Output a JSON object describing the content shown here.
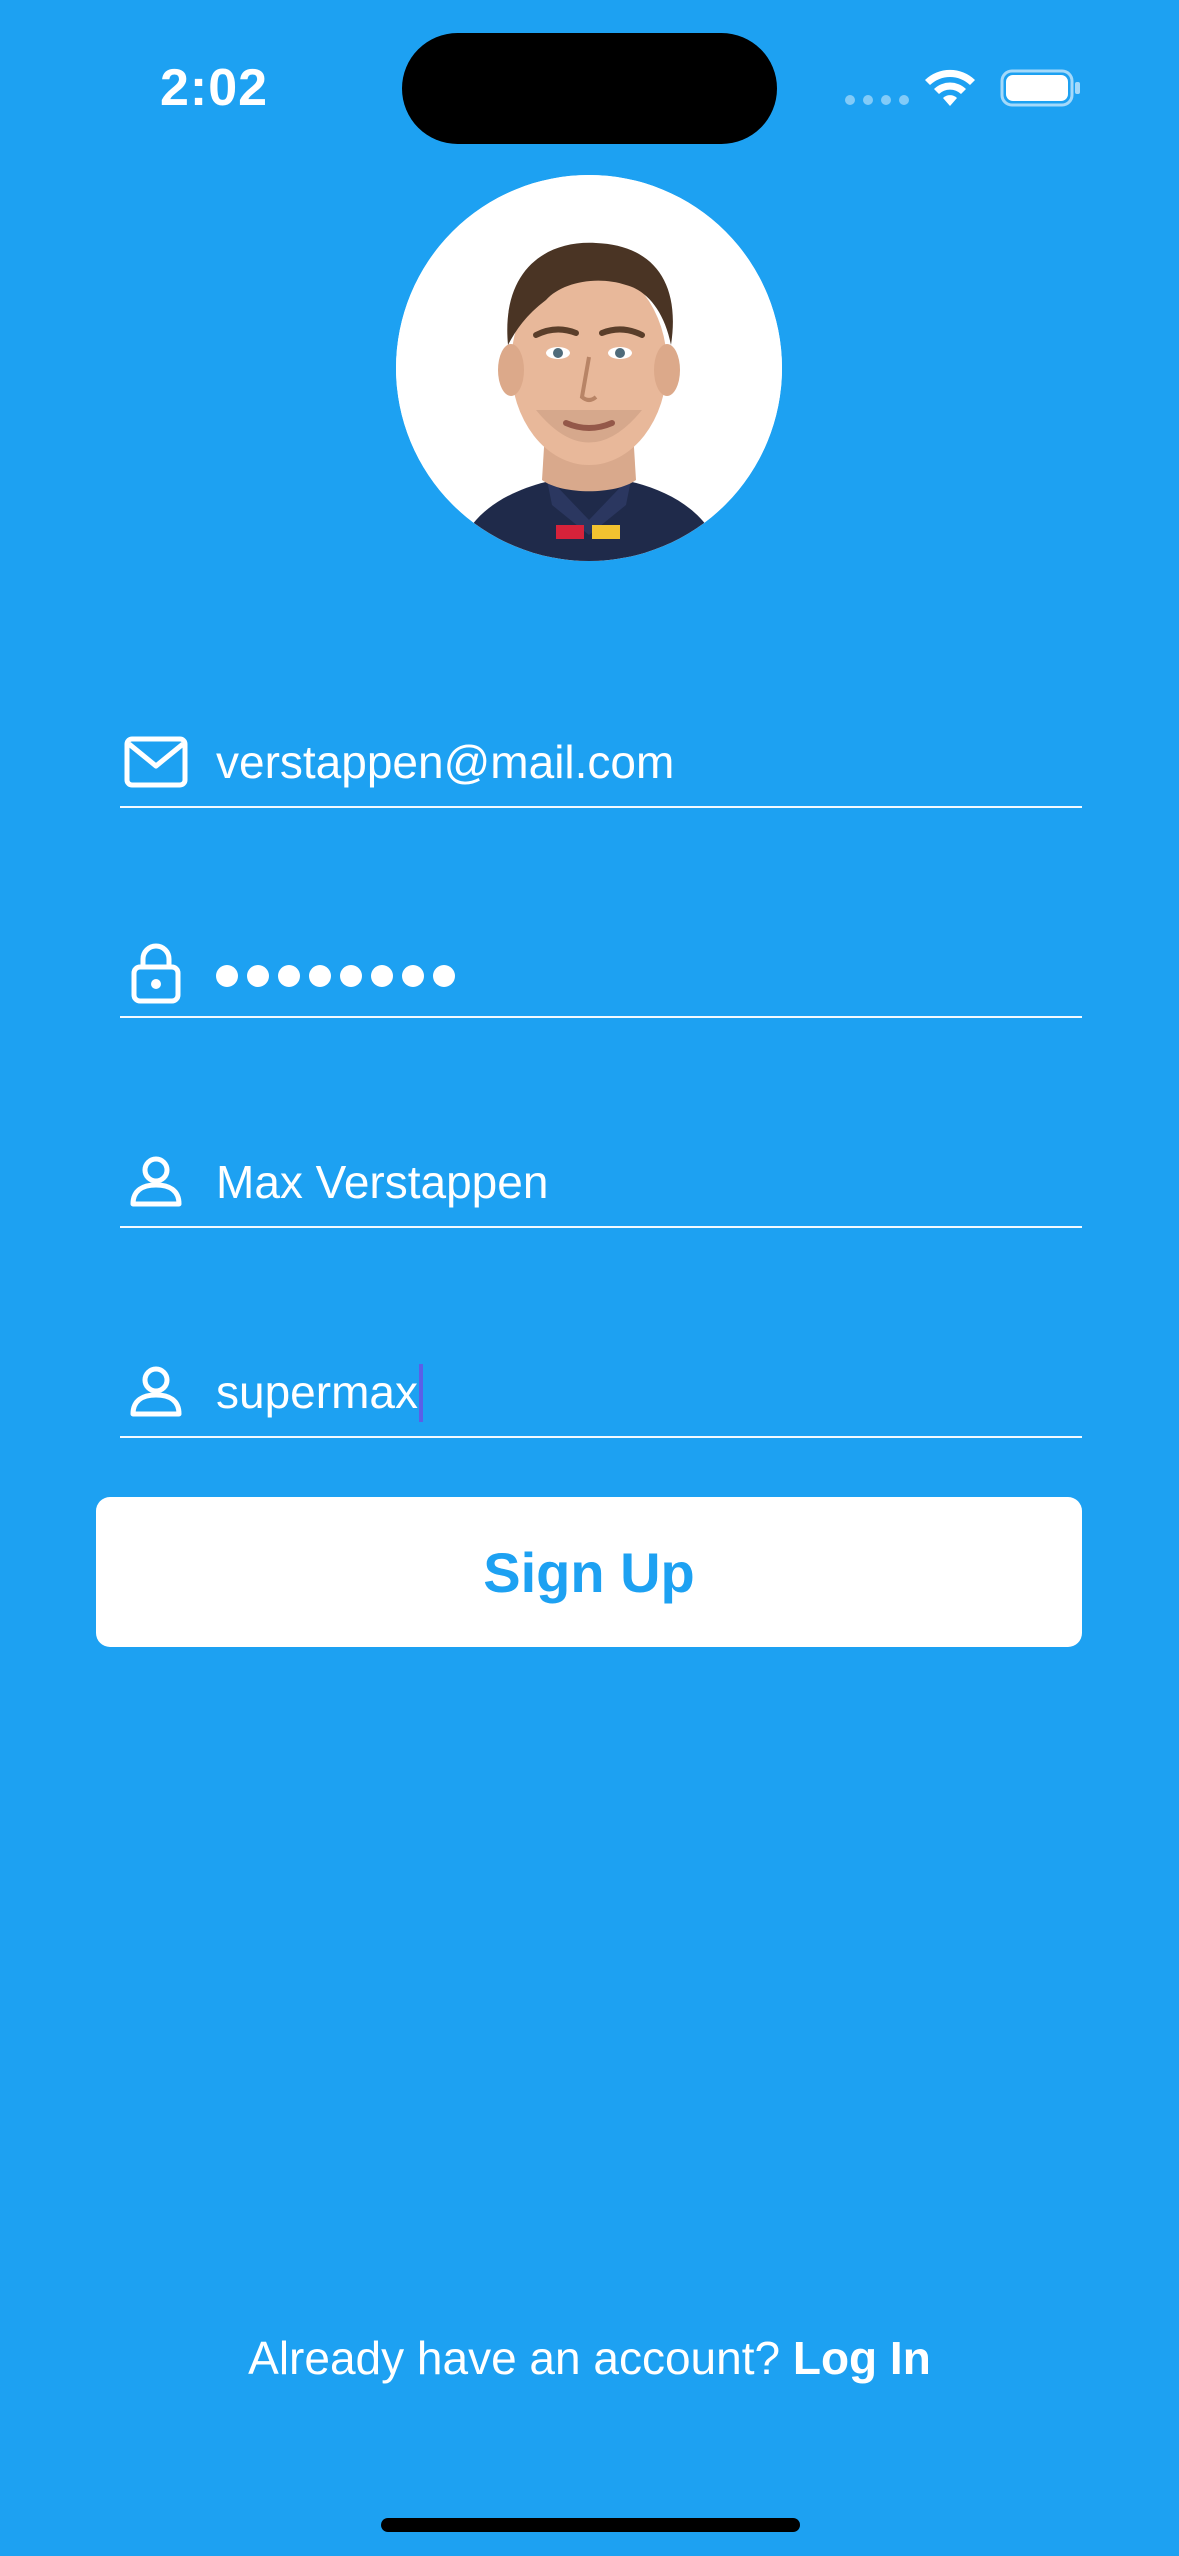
{
  "status_bar": {
    "time": "2:02"
  },
  "avatar": {
    "description_icon": "profile-photo"
  },
  "form": {
    "email": {
      "icon": "envelope-icon",
      "value": "verstappen@mail.com"
    },
    "password": {
      "icon": "lock-icon",
      "masked_length": 8
    },
    "full_name": {
      "icon": "person-icon",
      "value": "Max Verstappen"
    },
    "username": {
      "icon": "person-icon",
      "value": "supermax"
    }
  },
  "signup_button": {
    "label": "Sign Up"
  },
  "footer": {
    "prompt": "Already have an account?",
    "link_label": "Log In"
  },
  "colors": {
    "background": "#1DA1F2",
    "button_background": "#FFFFFF",
    "button_text": "#1DA1F2",
    "caret": "#5B5FE8"
  }
}
